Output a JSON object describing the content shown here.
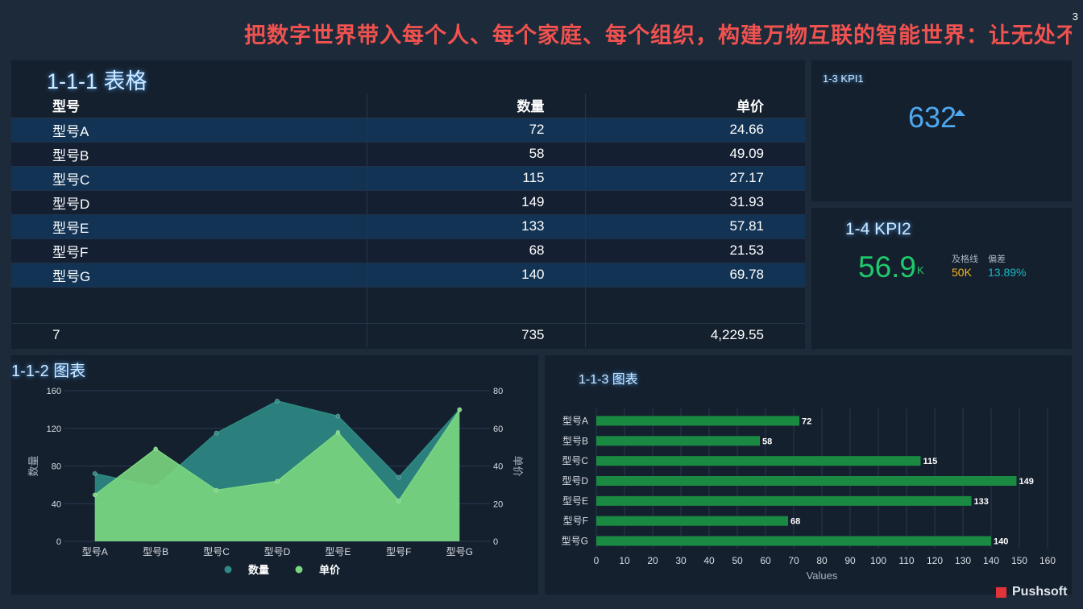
{
  "marquee": {
    "text": "把数字世界带入每个人、每个家庭、每个组织，构建万物互联的智能世界：让无处不",
    "page": "3"
  },
  "table": {
    "title": "1-1-1 表格",
    "headers": [
      "型号",
      "数量",
      "单价"
    ],
    "rows": [
      [
        "型号A",
        "72",
        "24.66"
      ],
      [
        "型号B",
        "58",
        "49.09"
      ],
      [
        "型号C",
        "115",
        "27.17"
      ],
      [
        "型号D",
        "149",
        "31.93"
      ],
      [
        "型号E",
        "133",
        "57.81"
      ],
      [
        "型号F",
        "68",
        "21.53"
      ],
      [
        "型号G",
        "140",
        "69.78"
      ]
    ],
    "footer": [
      "7",
      "735",
      "4,229.55"
    ]
  },
  "kpi1": {
    "title": "1-3 KPI1",
    "value": "632",
    "trend": "up",
    "color": "#4fa8ee"
  },
  "kpi2": {
    "title": "1-4 KPI2",
    "value": "56.9",
    "unit": "K",
    "pass_label": "及格线",
    "pass_value": "50K",
    "dev_label": "偏差",
    "dev_value": "13.89%"
  },
  "chart_data": [
    {
      "type": "area",
      "title": "1-1-2 图表",
      "categories": [
        "型号A",
        "型号B",
        "型号C",
        "型号D",
        "型号E",
        "型号F",
        "型号G"
      ],
      "ylabel": "数量",
      "y2label": "单价",
      "ylim": [
        0,
        160
      ],
      "y2lim": [
        0,
        80
      ],
      "yticks": [
        0,
        40,
        80,
        120,
        160
      ],
      "y2ticks": [
        0,
        20,
        40,
        60,
        80
      ],
      "series": [
        {
          "name": "数量",
          "axis": "left",
          "color": "#2e8a86",
          "values": [
            72,
            58,
            115,
            149,
            133,
            68,
            140
          ]
        },
        {
          "name": "单价",
          "axis": "right",
          "color": "#7ad67f",
          "values": [
            24.66,
            49.09,
            27.17,
            31.93,
            57.81,
            21.53,
            69.78
          ]
        }
      ],
      "legend": "bottom"
    },
    {
      "type": "bar",
      "orientation": "horizontal",
      "title": "1-1-3 图表",
      "categories": [
        "型号A",
        "型号B",
        "型号C",
        "型号D",
        "型号E",
        "型号F",
        "型号G"
      ],
      "values": [
        72,
        58,
        115,
        149,
        133,
        68,
        140
      ],
      "xlabel": "Values",
      "xlim": [
        0,
        160
      ],
      "xticks": [
        0,
        10,
        20,
        30,
        40,
        50,
        60,
        70,
        80,
        90,
        100,
        110,
        120,
        130,
        140,
        150,
        160
      ],
      "color": "#1a8a42"
    }
  ],
  "brand": "Pushsoft"
}
